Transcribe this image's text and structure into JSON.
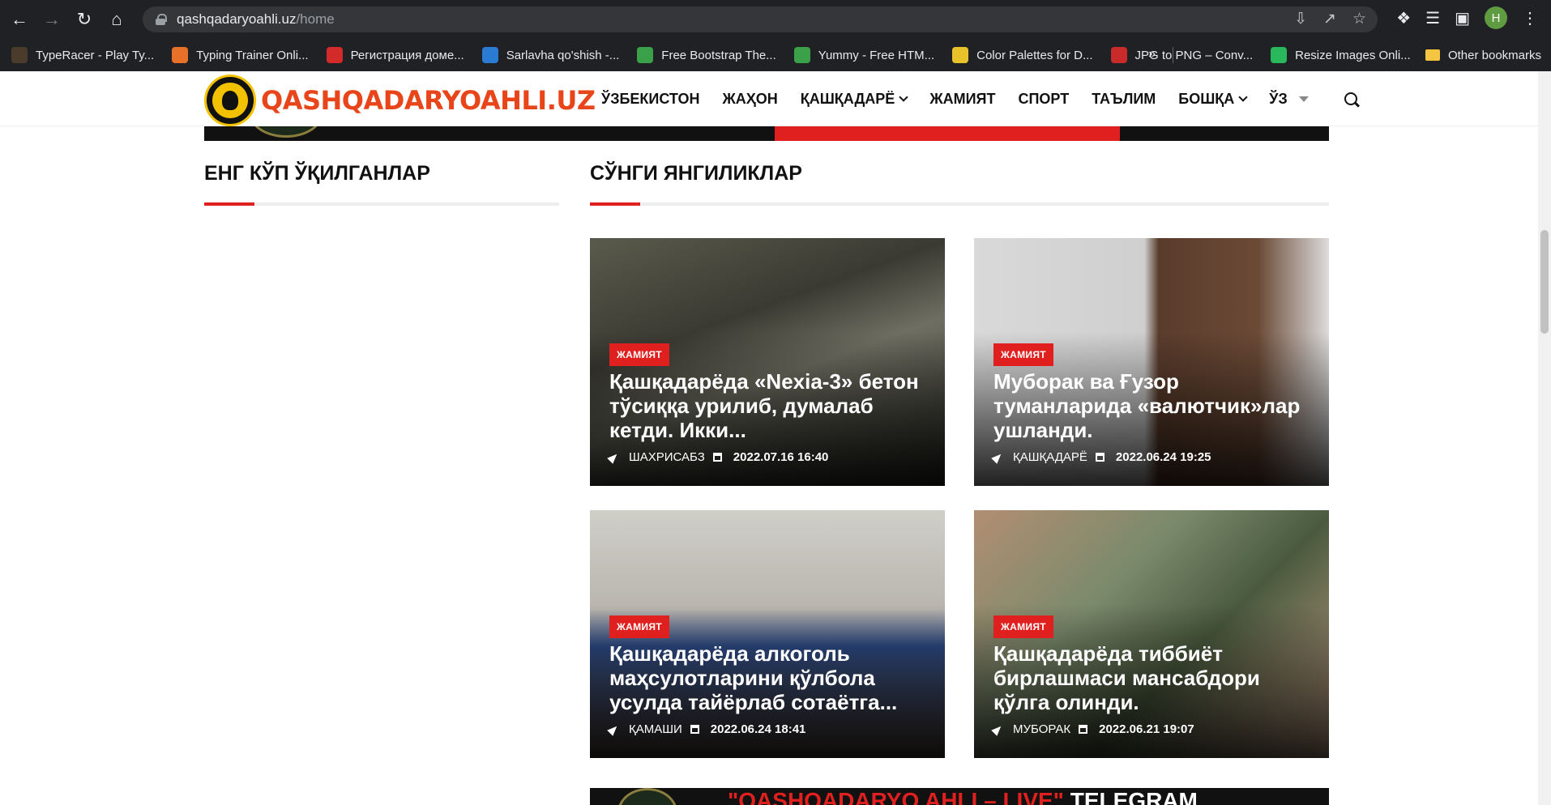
{
  "browser": {
    "url_host": "qashqadaryoahli.uz",
    "url_path": "/home",
    "avatar_letter": "H",
    "bookmarks": [
      {
        "label": "TypeRacer - Play Ty...",
        "color": "#4a3b2a"
      },
      {
        "label": "Typing Trainer Onli...",
        "color": "#e8712a"
      },
      {
        "label": "Регистрация доме...",
        "color": "#d32a2a"
      },
      {
        "label": "Sarlavha qo'shish -...",
        "color": "#2a7bd3"
      },
      {
        "label": "Free Bootstrap The...",
        "color": "#3aa14a"
      },
      {
        "label": "Yummy - Free HTM...",
        "color": "#3aa14a"
      },
      {
        "label": "Color Palettes for D...",
        "color": "#e8c22a"
      },
      {
        "label": "JPG to PNG – Conv...",
        "color": "#c92a2a"
      },
      {
        "label": "Resize Images Onli...",
        "color": "#2ab85c"
      }
    ],
    "more": "»",
    "other_bookmarks": "Other bookmarks"
  },
  "site": {
    "logo_text": "QASHQADARYOAHLI.UZ",
    "nav": [
      {
        "label": "ЎЗБЕКИСТОН",
        "dropdown": false
      },
      {
        "label": "ЖАҲОН",
        "dropdown": false
      },
      {
        "label": "ҚАШҚАДАРЁ",
        "dropdown": true
      },
      {
        "label": "ЖАМИЯТ",
        "dropdown": false
      },
      {
        "label": "СПОРТ",
        "dropdown": false
      },
      {
        "label": "ТАЪЛИМ",
        "dropdown": false
      },
      {
        "label": "БОШҚА",
        "dropdown": true
      }
    ],
    "lang": "ЎЗ"
  },
  "sections": {
    "most_read": "ЕНГ КЎП ЎҚИЛГАНЛАР",
    "latest": "СЎНГИ ЯНГИЛИКЛАР"
  },
  "articles": [
    {
      "category": "ЖАМИЯТ",
      "title": "Қашқадарёда «Nexia-3» бетон тўсиққа урилиб, думалаб кетди. Икки...",
      "location": "ШАХРИСАБЗ",
      "date": "2022.07.16 16:40"
    },
    {
      "category": "ЖАМИЯТ",
      "title": "Муборак ва Ғузор туманларида «валютчик»лар ушланди.",
      "location": "ҚАШҚАДАРЁ",
      "date": "2022.06.24 19:25"
    },
    {
      "category": "ЖАМИЯТ",
      "title": "Қашқадарёда алкоголь маҳсулотларини қўлбола усулда тайёрлаб сотаётга...",
      "location": "ҚАМАШИ",
      "date": "2022.06.24 18:41"
    },
    {
      "category": "ЖАМИЯТ",
      "title": "Қашқадарёда тиббиёт бирлашмаси мансабдори қўлга олинди.",
      "location": "МУБОРАК",
      "date": "2022.06.21 19:07"
    }
  ],
  "bottom_banner": {
    "red_text": "\"QASHQADARYO AHLI – LIVE\"",
    "white_text": " TELEGRAM"
  },
  "colors": {
    "accent": "#e0201f",
    "logo": "#e8461a",
    "chrome": "#202124"
  }
}
